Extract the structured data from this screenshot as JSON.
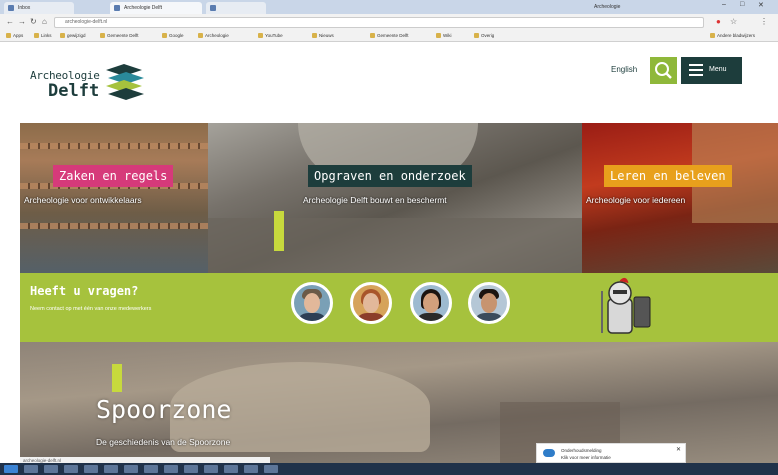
{
  "browser": {
    "tabs": [
      {
        "label": "Inbox"
      },
      {
        "label": "Archeologie Delft"
      },
      {
        "label": ""
      }
    ],
    "url": "archeologie-delft.nl",
    "user": "Archeologie",
    "bookmarks": [
      "Apps",
      "Links",
      "gewijzigd",
      "Gemeente Delft",
      "Google",
      "Archeologie",
      "YouTube",
      "Nieuws",
      "Gemeente Delft",
      "Wiki",
      "Overig",
      "Andere bladwijzers"
    ]
  },
  "site": {
    "logo_top": "Archeologie",
    "logo_bottom": "Delft",
    "lang_link": "English",
    "menu_label": "Menu",
    "accent_color": "#a6c23d",
    "dark_color": "#1d3d3c"
  },
  "tiles": [
    {
      "label": "Zaken en regels",
      "subtitle": "Archeologie voor ontwikkelaars",
      "color": "#d63a7a"
    },
    {
      "label": "Opgraven en onderzoek",
      "subtitle": "Archeologie Delft bouwt en beschermt",
      "color": "#1d3d3c"
    },
    {
      "label": "Leren en beleven",
      "subtitle": "Archeologie voor iedereen",
      "color": "#e8a01c"
    }
  ],
  "question": {
    "title": "Heeft u vragen?",
    "text": "Neem contact op met één van onze medewerkers"
  },
  "hero": {
    "title": "Spoorzone",
    "subtitle": "De geschiedenis van de Spoorzone"
  },
  "notification": {
    "line1": "Onderhoudsmelding",
    "line2": "Klik voor meer informatie"
  },
  "status_url": "archeologie-delft.nl"
}
